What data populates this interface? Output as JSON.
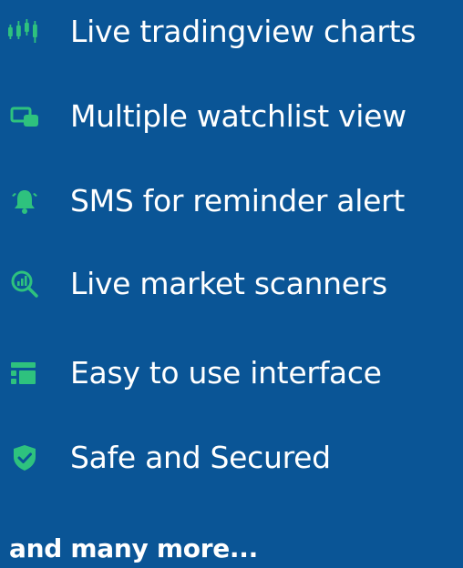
{
  "accent_color": "#2ec27e",
  "background_color": "#0a5596",
  "features": [
    {
      "label": "Live tradingview charts",
      "icon": "candlestick-chart-icon"
    },
    {
      "label": "Multiple watchlist view",
      "icon": "multiple-windows-icon"
    },
    {
      "label": "SMS for reminder alert",
      "icon": "alarm-bell-icon"
    },
    {
      "label": "Live market scanners",
      "icon": "search-analytics-icon"
    },
    {
      "label": "Easy to use interface",
      "icon": "list-layout-icon"
    },
    {
      "label": "Safe and Secured",
      "icon": "shield-check-icon"
    }
  ],
  "footer": {
    "more_text": "and many more..."
  }
}
